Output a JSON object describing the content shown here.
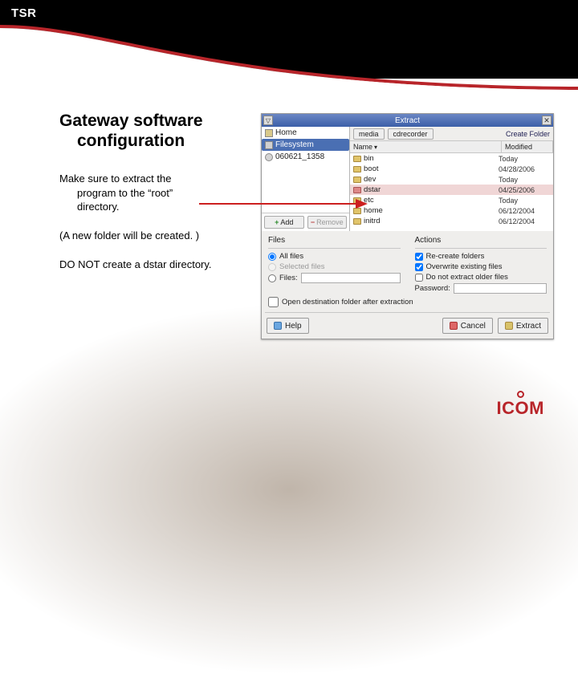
{
  "header": {
    "tsr": "TSR"
  },
  "slide": {
    "title_line1": "Gateway software",
    "title_line2": "configuration",
    "p1_line1": "Make sure to extract the",
    "p1_line2": "program to the “root”",
    "p1_line3": "directory.",
    "p2": "(A new folder will be created. )",
    "p3": "DO NOT create a dstar directory."
  },
  "dialog": {
    "title": "Extract",
    "close_glyph": "✕",
    "expand_glyph": "▽",
    "tree": {
      "home": "Home",
      "filesystem": "Filesystem",
      "folder": "060621_1358",
      "add": "Add",
      "remove": "Remove"
    },
    "crumb": {
      "btn1": "media",
      "btn2": "cdrecorder",
      "create": "Create Folder"
    },
    "list": {
      "head_name": "Name",
      "head_mod": "Modified",
      "rows": [
        {
          "name": "bin",
          "mod": "Today"
        },
        {
          "name": "boot",
          "mod": "04/28/2006"
        },
        {
          "name": "dev",
          "mod": "Today"
        },
        {
          "name": "dstar",
          "mod": "04/25/2006"
        },
        {
          "name": "etc",
          "mod": "Today"
        },
        {
          "name": "home",
          "mod": "06/12/2004"
        },
        {
          "name": "initrd",
          "mod": "06/12/2004"
        }
      ]
    },
    "files": {
      "heading": "Files",
      "all": "All files",
      "selected": "Selected files",
      "files_label": "Files:"
    },
    "actions": {
      "heading": "Actions",
      "recreate": "Re-create folders",
      "overwrite": "Overwrite existing files",
      "older": "Do not extract older files",
      "password": "Password:"
    },
    "open_after": "Open destination folder after extraction",
    "buttons": {
      "help": "Help",
      "cancel": "Cancel",
      "extract": "Extract"
    }
  },
  "logo": {
    "text": "ICOM"
  }
}
